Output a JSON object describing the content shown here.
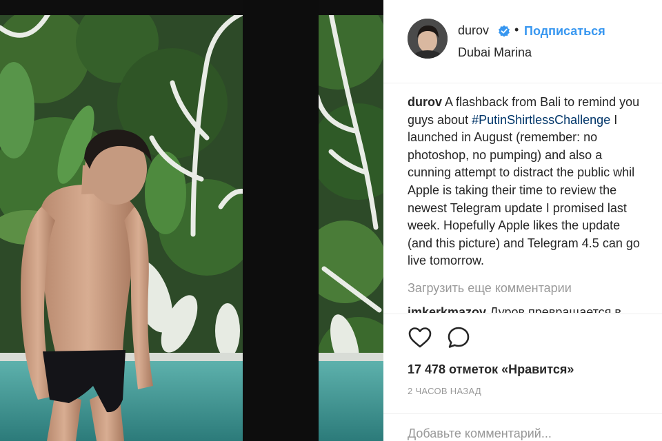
{
  "post": {
    "username": "durov",
    "follow_label": "Подписаться",
    "separator": "•",
    "location": "Dubai Marina"
  },
  "caption": {
    "username": "durov",
    "line1_text": " A flashback from Bali to remind you",
    "line2_prefix": "guys about ",
    "hashtag": "#PutinShirtlessChallenge",
    "line2_suffix": " I",
    "lines": [
      "launched in August (remember: no",
      "photoshop, no pumping) and also a",
      "cunning attempt to distract the public whil",
      "Apple is taking their time to review the",
      "newest Telegram update I promised last",
      "week. Hopefully Apple likes the update",
      "(and this picture) and Telegram 4.5 can go",
      "live tomorrow."
    ]
  },
  "comments": {
    "load_more": "Загрузить еще комментарии",
    "partial_user": "imkerkmazov",
    "partial_text": " Дуров превращается в"
  },
  "actions": {
    "like_icon": "heart-outline-icon",
    "comment_icon": "speech-bubble-icon",
    "likes_text": "17 478 отметок «Нравится»",
    "time_ago": "2 ЧАСОВ НАЗАД",
    "comment_placeholder": "Добавьте комментарий..."
  },
  "colors": {
    "link_blue": "#3897f0",
    "hashtag": "#003569",
    "muted": "#999999",
    "text": "#262626"
  }
}
